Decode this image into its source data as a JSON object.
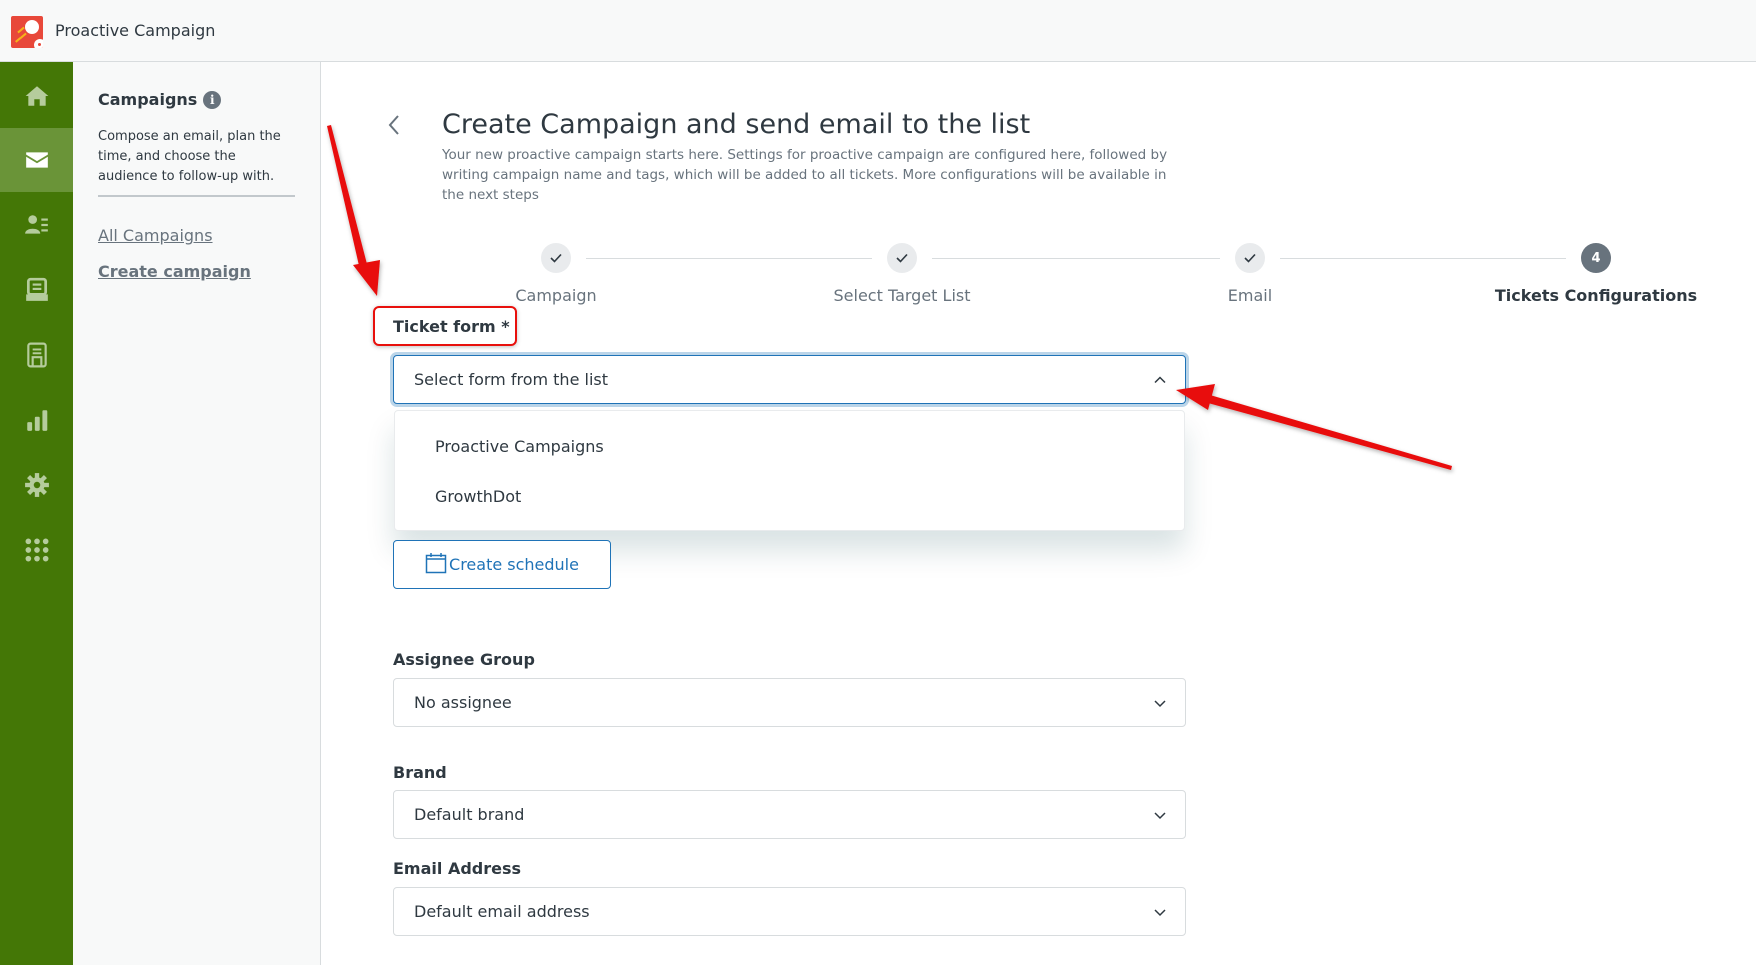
{
  "app": {
    "title": "Proactive Campaign",
    "logo_icon": "rocket-ball-logo"
  },
  "nav": {
    "items": [
      {
        "name": "home",
        "icon": "home-icon",
        "active": false
      },
      {
        "name": "campaigns",
        "icon": "envelope-icon",
        "active": true
      },
      {
        "name": "contacts",
        "icon": "user-list-icon",
        "active": false
      },
      {
        "name": "inbox",
        "icon": "inbox-tray-icon",
        "active": false
      },
      {
        "name": "forms",
        "icon": "form-document-icon",
        "active": false
      },
      {
        "name": "reports",
        "icon": "bar-chart-icon",
        "active": false
      },
      {
        "name": "settings",
        "icon": "gear-icon",
        "active": false
      },
      {
        "name": "apps",
        "icon": "grid-dots-icon",
        "active": false
      }
    ],
    "colors": {
      "background": "#447706",
      "active": "#6a9438",
      "icon": "#b5cc9c",
      "active_icon": "#ffffff"
    }
  },
  "subnav": {
    "title": "Campaigns",
    "info_icon": "i",
    "description": "Compose an email, plan the time, and choose the audience to follow-up with.",
    "links": [
      "All Campaigns",
      "Create campaign"
    ]
  },
  "page": {
    "back_icon": "chevron-left-icon",
    "title": "Create Campaign and send email to the list",
    "description": "Your new proactive campaign starts here. Settings for proactive campaign are configured here, followed by writing campaign name and tags, which will be added to all tickets. More configurations will be available in the next steps"
  },
  "stepper": {
    "steps": [
      {
        "label": "Campaign",
        "state": "done",
        "marker": "✓"
      },
      {
        "label": "Select Target List",
        "state": "done",
        "marker": "✓"
      },
      {
        "label": "Email",
        "state": "done",
        "marker": "✓"
      },
      {
        "label": "Tickets Configurations",
        "state": "current",
        "marker": "4"
      }
    ]
  },
  "form": {
    "ticket_form": {
      "label": "Ticket form *",
      "placeholder": "Select form from the list",
      "open": true,
      "options": [
        "Proactive Campaigns",
        "GrowthDot"
      ]
    },
    "schedule_button": "Create schedule",
    "assignee_group": {
      "label": "Assignee Group",
      "value": "No assignee"
    },
    "brand": {
      "label": "Brand",
      "value": "Default brand"
    },
    "email_address": {
      "label": "Email Address",
      "value": "Default email address"
    }
  },
  "annotations": {
    "color": "#e8100c",
    "arrows": [
      "arrow-to-ticket-form-label",
      "arrow-to-dropdown-chevron"
    ],
    "highlight": "ticket-form-label-highlight"
  }
}
